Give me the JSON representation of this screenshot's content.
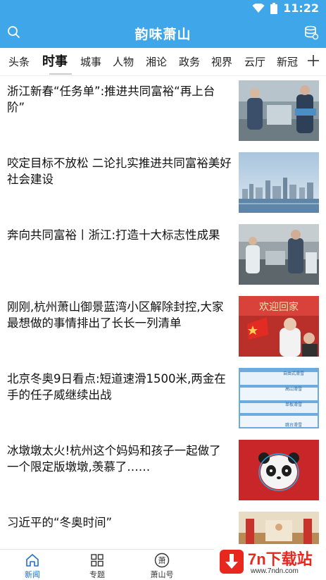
{
  "status_bar": {
    "time": "11:22",
    "icons": [
      "wifi-icon",
      "battery-icon"
    ]
  },
  "header": {
    "title": "韵味萧山",
    "left_icon": "search-icon",
    "right_icon": "database-icon",
    "color": "#3fa7e9"
  },
  "channels": {
    "items": [
      "头条",
      "时事",
      "城事",
      "人物",
      "湘论",
      "政务",
      "视界",
      "云厅",
      "新冠"
    ],
    "active": "时事",
    "add_icon": "plus-icon"
  },
  "news": [
    {
      "title": "浙江新春“任务单”:推进共同富裕“再上台阶”"
    },
    {
      "title": "咬定目标不放松 二论扎实推进共同富裕美好社会建设"
    },
    {
      "title": "奔向共同富裕丨浙江:打造十大标志性成果"
    },
    {
      "title": "刚刚,杭州萧山御景蓝湾小区解除封控,大家最想做的事情排出了长长一列清单"
    },
    {
      "title": "北京冬奥9日看点:短道速滑1500米,两金在手的任子威继续出战"
    },
    {
      "title": "冰墩墩太火!杭州这个妈妈和孩子一起做了一个限定版墩墩,羡慕了……"
    },
    {
      "title": "习近平的“冬奥时间”"
    }
  ],
  "thumb4_texts": [
    "欢迎回家"
  ],
  "thumb5_texts": [
    "自由式滑雪",
    "高山滑雪",
    "单板滑雪",
    "跳台滑雪"
  ],
  "bottom_nav": {
    "tabs": [
      {
        "label": "新闻",
        "icon": "home-icon",
        "active": true
      },
      {
        "label": "专题",
        "icon": "grid-icon",
        "active": false
      },
      {
        "label": "萧山号",
        "icon": "seal-icon",
        "active": false
      }
    ],
    "seal_char": "萧"
  },
  "watermark": {
    "name": "7n下载站",
    "url": "www.7ndn.com"
  }
}
